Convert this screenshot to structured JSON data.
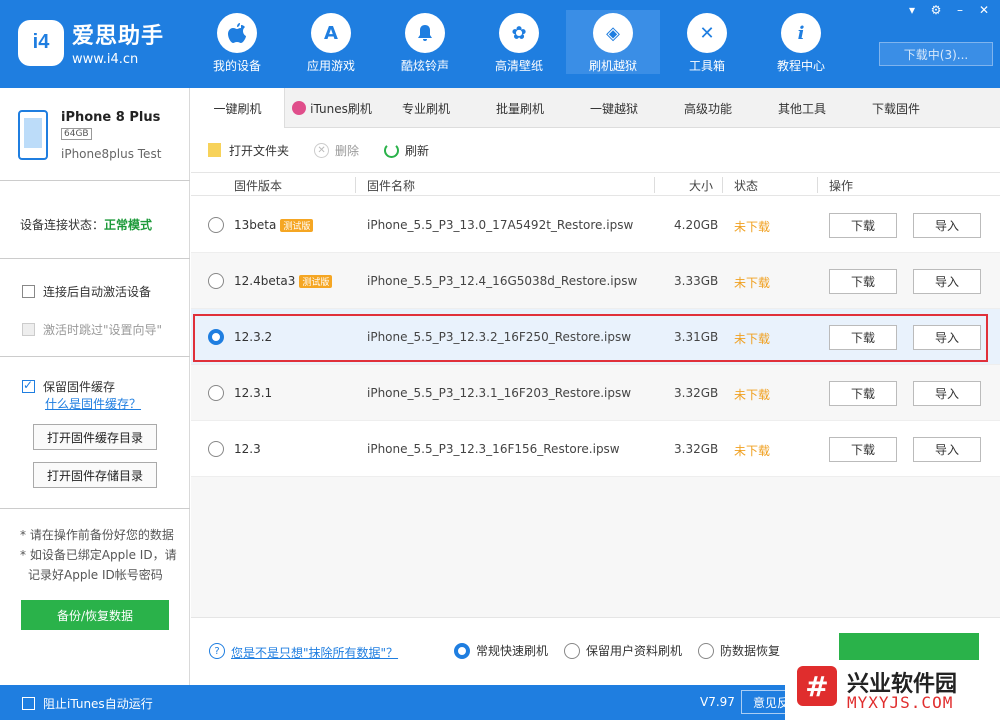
{
  "app": {
    "logo_badge": "i4",
    "title": "爱思助手",
    "url": "www.i4.cn",
    "accent_color": "#1f7ee0"
  },
  "nav": [
    {
      "label": "我的设备",
      "icon": "apple-icon",
      "glyph": ""
    },
    {
      "label": "应用游戏",
      "icon": "app-store-icon",
      "glyph": "A"
    },
    {
      "label": "酷炫铃声",
      "icon": "bell-icon",
      "glyph": "♪"
    },
    {
      "label": "高清壁纸",
      "icon": "flower-icon",
      "glyph": "✿"
    },
    {
      "label": "刷机越狱",
      "icon": "box-icon",
      "glyph": "◈"
    },
    {
      "label": "工具箱",
      "icon": "tools-icon",
      "glyph": "✕"
    },
    {
      "label": "教程中心",
      "icon": "info-icon",
      "glyph": "i"
    }
  ],
  "download_status": "下载中(3)...",
  "device": {
    "name": "iPhone 8 Plus",
    "capacity": "64GB",
    "subtitle": "iPhone8plus Test",
    "conn_label": "设备连接状态：",
    "conn_status": "正常模式"
  },
  "sidebar": {
    "auto_activate": "连接后自动激活设备",
    "skip_setup": "激活时跳过\"设置向导\"",
    "keep_cache": "保留固件缓存",
    "what_cache": "什么是固件缓存？",
    "open_cache_dir": "打开固件缓存目录",
    "open_store_dir": "打开固件存储目录",
    "note1": "* 请在操作前备份好您的数据",
    "note2": "* 如设备已绑定Apple ID，请",
    "note3": "记录好Apple ID帐号密码",
    "backup_btn": "备份/恢复数据"
  },
  "tabs": [
    "一键刷机",
    "iTunes刷机",
    "专业刷机",
    "批量刷机",
    "一键越狱",
    "高级功能",
    "其他工具",
    "下载固件"
  ],
  "toolbar": {
    "open_folder": "打开文件夹",
    "delete": "删除",
    "refresh": "刷新"
  },
  "table": {
    "headers": {
      "version": "固件版本",
      "name": "固件名称",
      "size": "大小",
      "status": "状态",
      "action": "操作"
    },
    "rows": [
      {
        "version": "13beta",
        "badge": "测试版",
        "name": "iPhone_5.5_P3_13.0_17A5492t_Restore.ipsw",
        "size": "4.20GB",
        "status": "未下载",
        "download": "下载",
        "import": "导入",
        "selected": false
      },
      {
        "version": "12.4beta3",
        "badge": "测试版",
        "name": "iPhone_5.5_P3_12.4_16G5038d_Restore.ipsw",
        "size": "3.33GB",
        "status": "未下载",
        "download": "下载",
        "import": "导入",
        "selected": false
      },
      {
        "version": "12.3.2",
        "badge": "",
        "name": "iPhone_5.5_P3_12.3.2_16F250_Restore.ipsw",
        "size": "3.31GB",
        "status": "未下载",
        "download": "下载",
        "import": "导入",
        "selected": true
      },
      {
        "version": "12.3.1",
        "badge": "",
        "name": "iPhone_5.5_P3_12.3.1_16F203_Restore.ipsw",
        "size": "3.32GB",
        "status": "未下载",
        "download": "下载",
        "import": "导入",
        "selected": false
      },
      {
        "version": "12.3",
        "badge": "",
        "name": "iPhone_5.5_P3_12.3_16F156_Restore.ipsw",
        "size": "3.32GB",
        "status": "未下载",
        "download": "下载",
        "import": "导入",
        "selected": false
      }
    ]
  },
  "bottom": {
    "help_link": "您是不是只想\"抹除所有数据\"？",
    "opt_fast": "常规快速刷机",
    "opt_keep": "保留用户资料刷机",
    "opt_recover": "防数据恢复"
  },
  "footer": {
    "block_itunes": "阻止iTunes自动运行",
    "version": "V7.97",
    "feedback": "意见反"
  },
  "watermark": {
    "name": "兴业软件园",
    "url": "MYXYJS.COM"
  }
}
